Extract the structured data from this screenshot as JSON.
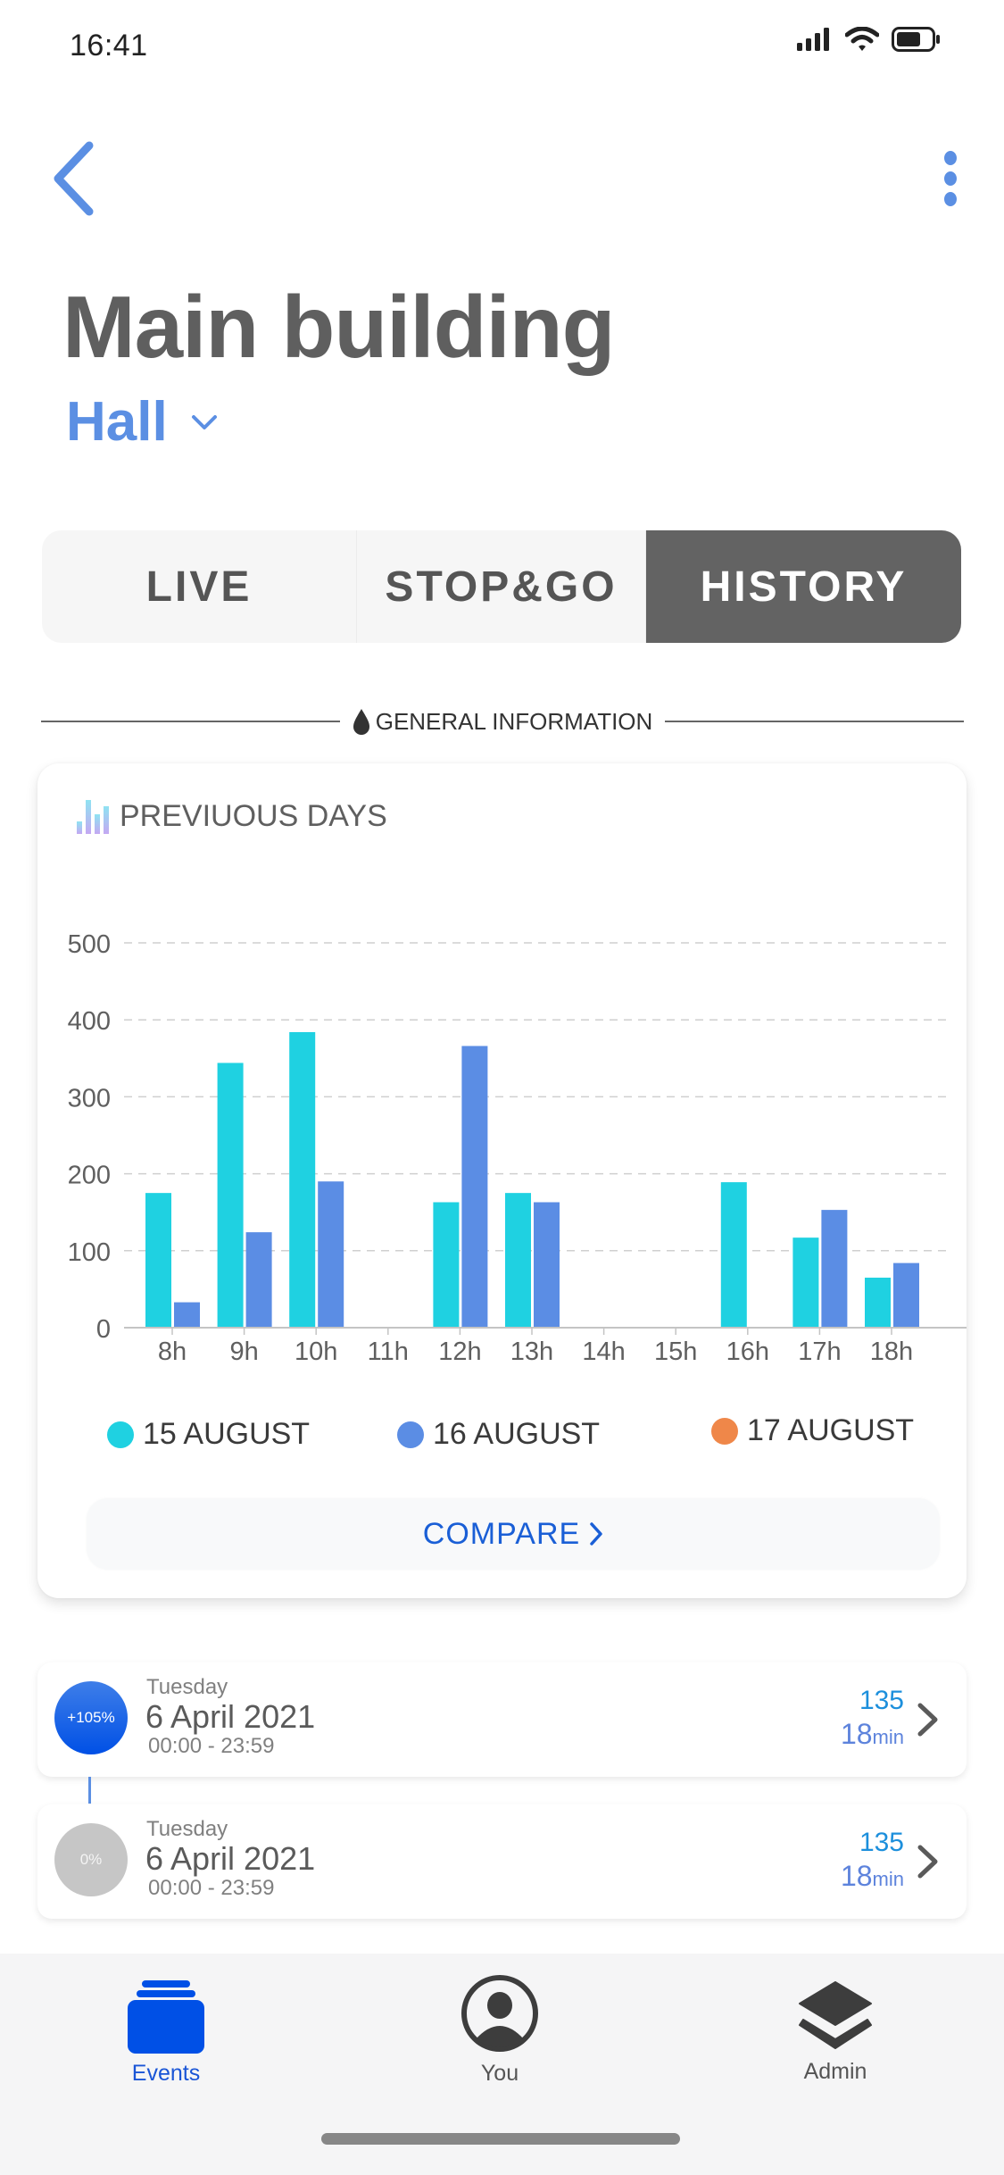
{
  "status_bar": {
    "time": "16:41",
    "icons": [
      "signal-icon",
      "wifi-icon",
      "battery-icon"
    ]
  },
  "header": {
    "back_icon": "chevron-left-icon",
    "menu_icon": "more-vertical-icon",
    "title": "Main building",
    "subtitle": "Hall",
    "subtitle_icon": "chevron-down-icon"
  },
  "tabs": [
    {
      "label": "LIVE",
      "active": false
    },
    {
      "label": "STOP&GO",
      "active": false
    },
    {
      "label": "HISTORY",
      "active": true
    }
  ],
  "section": {
    "icon": "drop-icon",
    "label": "GENERAL INFORMATION"
  },
  "card": {
    "title_icon": "bar-chart-icon",
    "title": "PREVIUOUS DAYS",
    "compare_label": "COMPARE",
    "compare_icon": "chevron-right-icon"
  },
  "colors": {
    "accent": "#5b8fe3",
    "series_15": "#1fd1e1",
    "series_16": "#5b8de4",
    "series_17": "#ef8749",
    "active_tab": "#636363",
    "tab_active_label": "#1a55d6"
  },
  "chart_data": {
    "type": "bar",
    "title": "PREVIUOUS DAYS",
    "xlabel": "",
    "ylabel": "",
    "ylim": [
      0,
      500
    ],
    "yticks": [
      0,
      100,
      200,
      300,
      400,
      500
    ],
    "grid": true,
    "legend_position": "bottom",
    "categories": [
      "8h",
      "9h",
      "10h",
      "11h",
      "12h",
      "13h",
      "14h",
      "15h",
      "16h",
      "17h",
      "18h"
    ],
    "series": [
      {
        "name": "15 AUGUST",
        "color": "#1fd1e1",
        "values": [
          175,
          344,
          384,
          0,
          163,
          175,
          0,
          0,
          189,
          117,
          65
        ]
      },
      {
        "name": "16 AUGUST",
        "color": "#5b8de4",
        "values": [
          33,
          124,
          190,
          0,
          366,
          163,
          0,
          0,
          0,
          153,
          84
        ]
      },
      {
        "name": "17 AUGUST",
        "color": "#ef8749",
        "values": [
          0,
          0,
          0,
          0,
          0,
          0,
          0,
          0,
          0,
          0,
          0
        ]
      }
    ]
  },
  "list": [
    {
      "badge": "+105%",
      "badge_type": "up",
      "day": "Tuesday",
      "date": "6 April 2021",
      "time_range": "00:00 - 23:59",
      "count": "135",
      "duration": "18",
      "duration_unit": "min"
    },
    {
      "badge": "0%",
      "badge_type": "zero",
      "day": "Tuesday",
      "date": "6 April 2021",
      "time_range": "00:00 - 23:59",
      "count": "135",
      "duration": "18",
      "duration_unit": "min"
    }
  ],
  "tabbar": [
    {
      "label": "Events",
      "icon": "events-icon",
      "active": true
    },
    {
      "label": "You",
      "icon": "user-circle-icon",
      "active": false
    },
    {
      "label": "Admin",
      "icon": "layers-icon",
      "active": false
    }
  ]
}
